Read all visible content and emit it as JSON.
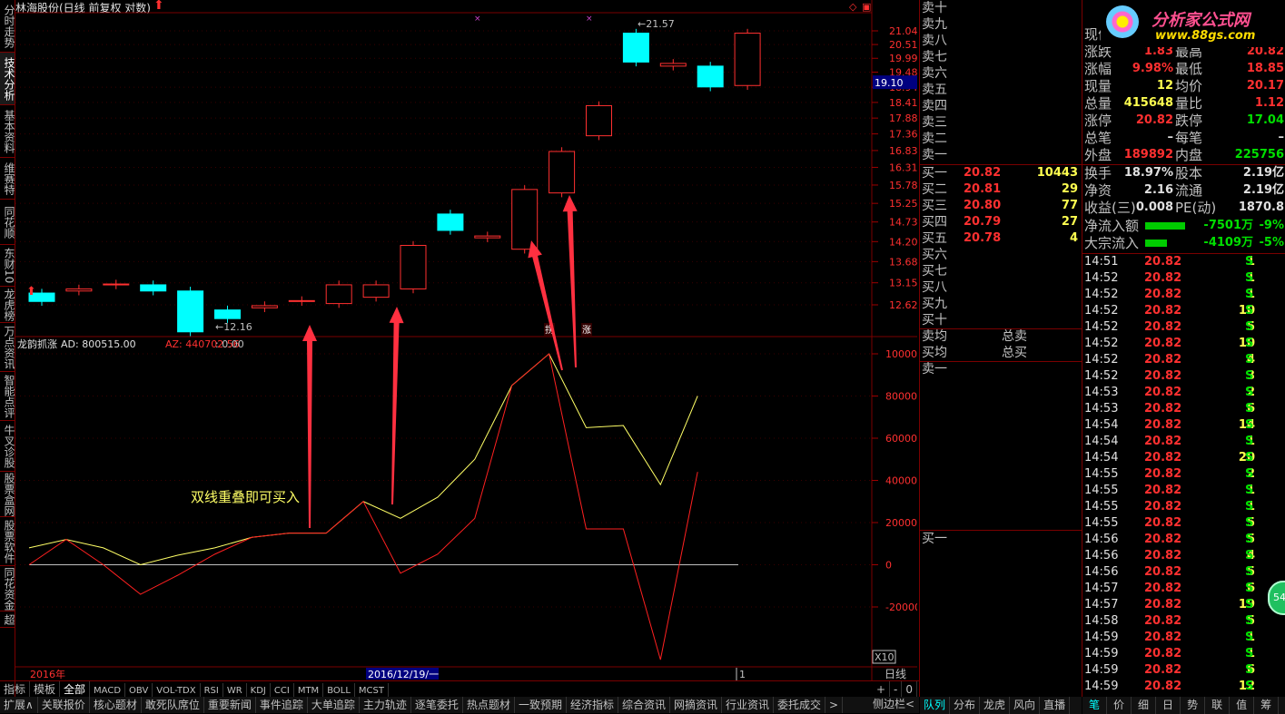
{
  "title": "林海股份(日线 前复权 对数)",
  "left_tabs": [
    "分时走势",
    "技术分析",
    "基本资料",
    "维赛特",
    "同花顺",
    "东财10",
    "龙虎榜",
    "万点资讯",
    "智能点评",
    "牛叉诊股",
    "股票盒网",
    "股票软件",
    "同花资金",
    "超"
  ],
  "price_axis": [
    "21.04",
    "20.51",
    "19.99",
    "19.48",
    "18.94",
    "18.41",
    "17.88",
    "17.36",
    "16.83",
    "16.31",
    "15.78",
    "15.25",
    "14.73",
    "14.20",
    "13.68",
    "13.15",
    "12.62"
  ],
  "current_price_label": "19.10",
  "high_label": "21.57",
  "low_label": "12.16",
  "signal_labels": [
    "拐",
    "涨"
  ],
  "indicator": {
    "name": "龙韵抓涨",
    "ad_label": "AD: 800515.00",
    "az_label": "AZ: 440702.56",
    "zero_label": ": 0.00"
  },
  "indicator_axis": [
    "100000",
    "80000",
    "60000",
    "40000",
    "20000",
    "0",
    "-20000"
  ],
  "annotation": "双线重叠即可买入",
  "x10_label": "X10",
  "date_left": "2016年",
  "date_cursor": "2016/12/19/一",
  "date_right": "1",
  "period_label": "日线",
  "zoom_buttons": [
    "+",
    "-",
    "0"
  ],
  "chart_data": {
    "type": "candlestick",
    "candles": [
      {
        "o": 12.9,
        "c": 12.7
      },
      {
        "o": 12.95,
        "c": 13.0
      },
      {
        "o": 13.1,
        "c": 13.12
      },
      {
        "o": 13.1,
        "c": 12.95
      },
      {
        "o": 12.95,
        "c": 12.0
      },
      {
        "o": 12.5,
        "c": 12.3
      },
      {
        "o": 12.55,
        "c": 12.6
      },
      {
        "o": 12.7,
        "c": 12.72
      },
      {
        "o": 12.65,
        "c": 13.1
      },
      {
        "o": 12.8,
        "c": 13.1
      },
      {
        "o": 13.0,
        "c": 14.1
      },
      {
        "o": 14.95,
        "c": 14.5
      },
      {
        "o": 14.3,
        "c": 14.35
      },
      {
        "o": 14.0,
        "c": 15.65
      },
      {
        "o": 15.55,
        "c": 16.8
      },
      {
        "o": 17.3,
        "c": 18.3
      },
      {
        "o": 20.95,
        "c": 19.85
      },
      {
        "o": 19.7,
        "c": 19.8
      },
      {
        "o": 19.7,
        "c": 18.95
      },
      {
        "o": 19.0,
        "c": 20.95
      }
    ],
    "ad_series": [
      8000,
      12000,
      8000,
      0,
      4500,
      8000,
      13000,
      15000,
      15000,
      30000,
      22000,
      32000,
      50000,
      85000,
      100000,
      65000,
      66000,
      38000,
      80000
    ],
    "az_series": [
      0,
      12000,
      0,
      -14000,
      -5000,
      5000,
      13000,
      15000,
      15000,
      30000,
      -4000,
      5000,
      22000,
      85000,
      100000,
      17000,
      17000,
      -45000,
      44000
    ]
  },
  "toolbar1": [
    "指标",
    "模板",
    "全部",
    "MACD",
    "OBV",
    "VOL-TDX",
    "RSI",
    "WR",
    "KDJ",
    "CCI",
    "MTM",
    "BOLL",
    "MCST"
  ],
  "toolbar2": [
    "扩展∧",
    "关联报价",
    "核心题材",
    "敢死队席位",
    "重要新闻",
    "事件追踪",
    "大单追踪",
    "主力轨迹",
    "逐笔委托",
    "热点题材",
    "一致预期",
    "经济指标",
    "综合资讯",
    "网摘资讯",
    "行业资讯",
    "委托成交",
    ">"
  ],
  "orderbook": {
    "sells": [
      "卖十",
      "卖九",
      "卖八",
      "卖七",
      "卖六",
      "卖五",
      "卖四",
      "卖三",
      "卖二",
      "卖一"
    ],
    "buys": [
      {
        "label": "买一",
        "price": "20.82",
        "vol": "10443"
      },
      {
        "label": "买二",
        "price": "20.81",
        "vol": "29"
      },
      {
        "label": "买三",
        "price": "20.80",
        "vol": "77"
      },
      {
        "label": "买四",
        "price": "20.79",
        "vol": "27"
      },
      {
        "label": "买五",
        "price": "20.78",
        "vol": "4"
      },
      {
        "label": "买六",
        "price": "",
        "vol": ""
      },
      {
        "label": "买七",
        "price": "",
        "vol": ""
      },
      {
        "label": "买八",
        "price": "",
        "vol": ""
      },
      {
        "label": "买九",
        "price": "",
        "vol": ""
      },
      {
        "label": "买十",
        "price": "",
        "vol": ""
      }
    ],
    "avg_sell": "卖均",
    "avg_buy": "买均",
    "total_sell": "总卖",
    "total_buy": "总买",
    "sell1": "卖一",
    "buy1": "买一",
    "bottom_label": "侧边栏<",
    "tabs": [
      "队列",
      "分布",
      "龙虎",
      "风向",
      "直播"
    ]
  },
  "logo": {
    "text": "分析家公式网",
    "url": "www.88gs.com"
  },
  "quote": {
    "rows": [
      [
        "现价",
        "",
        "最高",
        "20.82"
      ],
      [
        "涨跌",
        "1.83",
        "最高",
        "20.82"
      ],
      [
        "涨幅",
        "9.98%",
        "最低",
        "18.85"
      ],
      [
        "现量",
        "12",
        "均价",
        "20.17"
      ],
      [
        "总量",
        "415648",
        "量比",
        "1.12"
      ],
      [
        "涨停",
        "20.82",
        "跌停",
        "17.04"
      ],
      [
        "总笔",
        "–",
        "每笔",
        "–"
      ],
      [
        "外盘",
        "189892",
        "内盘",
        "225756"
      ],
      [
        "换手",
        "18.97%",
        "股本",
        "2.19亿"
      ],
      [
        "净资",
        "2.16",
        "流通",
        "2.19亿"
      ],
      [
        "收益(三)",
        "0.008",
        "PE(动)",
        "1870.8"
      ]
    ],
    "flow": [
      {
        "label": "净流入额",
        "value": "-7501万",
        "pct": "-9%"
      },
      {
        "label": "大宗流入",
        "value": "-4109万",
        "pct": "-5%"
      }
    ],
    "ticks": [
      [
        "14:51",
        "20.82",
        "1",
        "S"
      ],
      [
        "14:52",
        "20.82",
        "1",
        "S"
      ],
      [
        "14:52",
        "20.82",
        "1",
        "S"
      ],
      [
        "14:52",
        "20.82",
        "10",
        "S"
      ],
      [
        "14:52",
        "20.82",
        "5",
        "S"
      ],
      [
        "14:52",
        "20.82",
        "10",
        "S"
      ],
      [
        "14:52",
        "20.82",
        "4",
        "S"
      ],
      [
        "14:52",
        "20.82",
        "3",
        "S"
      ],
      [
        "14:53",
        "20.82",
        "2",
        "S"
      ],
      [
        "14:53",
        "20.82",
        "6",
        "S"
      ],
      [
        "14:54",
        "20.82",
        "14",
        "S"
      ],
      [
        "14:54",
        "20.82",
        "1",
        "S"
      ],
      [
        "14:54",
        "20.82",
        "20",
        "S"
      ],
      [
        "14:55",
        "20.82",
        "2",
        "S"
      ],
      [
        "14:55",
        "20.82",
        "1",
        "S"
      ],
      [
        "14:55",
        "20.82",
        "1",
        "S"
      ],
      [
        "14:55",
        "20.82",
        "5",
        "S"
      ],
      [
        "14:56",
        "20.82",
        "5",
        "S"
      ],
      [
        "14:56",
        "20.82",
        "4",
        "S"
      ],
      [
        "14:56",
        "20.82",
        "5",
        "S"
      ],
      [
        "14:57",
        "20.82",
        "6",
        "S"
      ],
      [
        "14:57",
        "20.82",
        "19",
        "S"
      ],
      [
        "14:58",
        "20.82",
        "5",
        "S"
      ],
      [
        "14:59",
        "20.82",
        "1",
        "S"
      ],
      [
        "14:59",
        "20.82",
        "1",
        "S"
      ],
      [
        "14:59",
        "20.82",
        "6",
        "S"
      ],
      [
        "14:59",
        "20.82",
        "12",
        "S"
      ]
    ],
    "tabs": [
      "笔",
      "价",
      "细",
      "日",
      "势",
      "联",
      "值",
      "筹"
    ],
    "badge": "54"
  },
  "colors": {
    "up": "#ff3030",
    "down": "#00ffff",
    "ad_line": "#ffff66",
    "az_line": "#ff2020",
    "border": "#7a0000"
  }
}
